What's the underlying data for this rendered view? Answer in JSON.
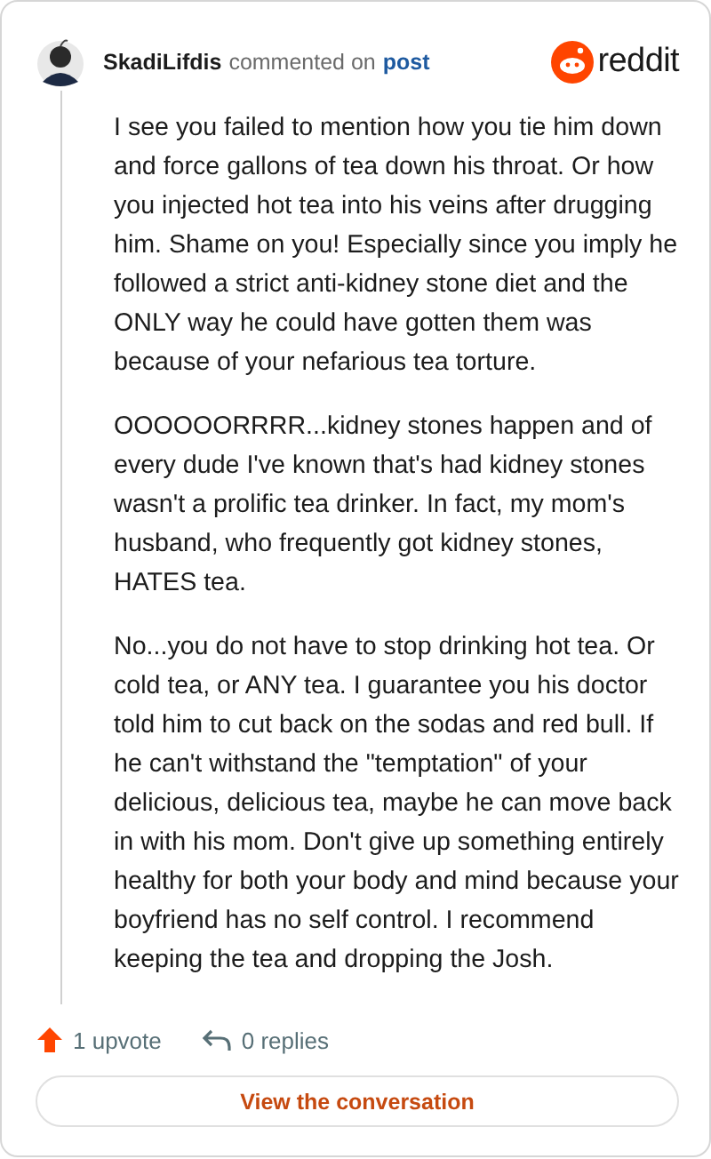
{
  "header": {
    "username": "SkadiLifdis",
    "action": "commented on",
    "link": "post",
    "logo_text": "reddit"
  },
  "comment": {
    "paragraphs": [
      "I see you failed to mention how you tie him down and force gallons of tea down his throat. Or how you injected hot tea into his veins after drugging him. Shame on you! Especially since you imply he followed a strict anti-kidney stone diet and the ONLY way he could have gotten them was because of your nefarious tea torture.",
      "OOOOOORRRR...kidney stones happen and of every dude I've known that's had kidney stones wasn't a prolific tea drinker. In fact, my mom's husband, who frequently got kidney stones, HATES tea.",
      "No...you do not have to stop drinking hot tea. Or cold tea, or ANY tea. I guarantee you his doctor told him to cut back on the sodas and red bull. If he can't withstand the \"temptation\" of your delicious, delicious tea, maybe he can move back in with his mom. Don't give up something entirely healthy for both your body and mind because your boyfriend has no self control. I recommend keeping the tea and dropping the Josh."
    ]
  },
  "footer": {
    "upvotes": "1 upvote",
    "replies": "0 replies",
    "button": "View the conversation"
  }
}
